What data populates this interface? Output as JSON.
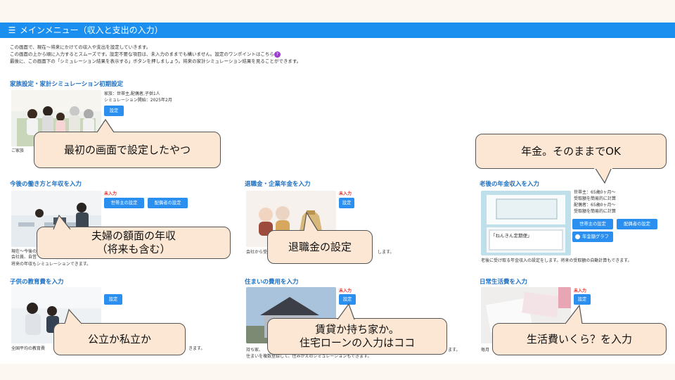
{
  "header": {
    "icon": "list-icon",
    "title": "メインメニュー（収入と支出の入力）"
  },
  "intro": {
    "line1": "この画面で、現在〜将来にかけての収入や支出を設定していきます。",
    "line2": "この画面の上から順に入力するとスムーズです。設定不要な項目は、未入力のままでも構いません。設定のワンポイントはこちら",
    "help_icon": "?",
    "line3": "最後に、この画面下の「シミュレーション結果を表示する」ボタンを押しましょう。将来の家計シミュレーション結果を見ることができます。"
  },
  "family": {
    "title": "家族設定・家計シミュレーション初期設定",
    "info1": "家族：世帯主,配偶者,子供1人",
    "info2": "シミュレーション開始：2025年2月",
    "btn": "設定",
    "desc_fragment": "ご家族"
  },
  "work": {
    "title": "今後の働き方と年収を入力",
    "status": "未入力",
    "btn_head": "世帯主の設定",
    "btn_spouse": "配偶者の設定",
    "desc1": "現在〜今後の",
    "desc2": "会社員、自営",
    "desc3": "将来の年収もシミュレーションできます。"
  },
  "retire": {
    "title": "退職金・企業年金を入力",
    "status": "未入力",
    "btn": "設定",
    "desc_start": "会社から受",
    "desc_end": "します。"
  },
  "pension": {
    "title": "老後の年金収入を入力",
    "l1": "世帯主：65歳0ヶ月〜",
    "l2": "受取額を簡易的に計算",
    "l3": "配偶者：65歳0ヶ月〜",
    "l4": "受取額を簡易的に計算",
    "btn_head": "世帯主の設定",
    "btn_spouse": "配偶者の設定",
    "btn_graph": "年金額グラフ",
    "desc": "老後に受け取る年金収入の設定をします。将来の受取額の自動計算もできます。",
    "photo_text": "「ねんきん定期便」"
  },
  "edu": {
    "title": "子供の教育費を入力",
    "btn": "設定",
    "desc_start": "全国平均の教育費",
    "desc_end": "きます。"
  },
  "housing": {
    "title": "住まいの費用を入力",
    "status": "未入力",
    "btn": "設定",
    "desc1": "持ち家、",
    "desc1_end": "ます。",
    "desc2": "住まいを複数登録して、住みかえのシミュレーションもできます。"
  },
  "living": {
    "title": "日常生活費を入力",
    "status": "未入力",
    "btn": "設定",
    "desc_start": "毎月"
  },
  "bubbles": {
    "b1": "最初の画面で設定したやつ",
    "b2": "年金。そのままでOK",
    "b3_l1": "夫婦の額面の年収",
    "b3_l2": "（将来も含む）",
    "b4": "退職金の設定",
    "b5": "公立か私立か",
    "b6_l1": "賃貸か持ち家か。",
    "b6_l2": "住宅ローンの入力はココ",
    "b7": "生活費いくら？を入力"
  },
  "colors": {
    "header": "#1a8ff0",
    "button": "#2b8ff0",
    "bubble": "#fbe7d4",
    "status": "#e0302a",
    "title": "#1a6fc4"
  }
}
